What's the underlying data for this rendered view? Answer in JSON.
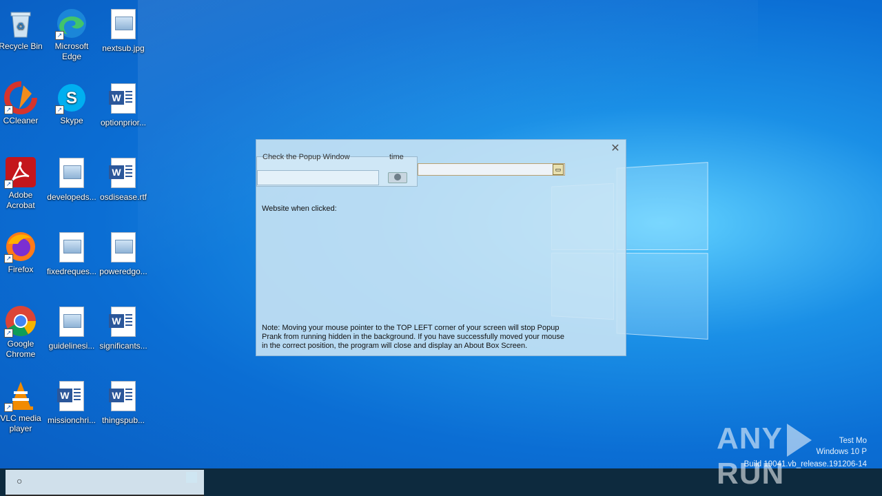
{
  "desktop": {
    "icons": [
      {
        "label": "Recycle Bin",
        "icon": "recycle-bin-icon"
      },
      {
        "label": "Microsoft Edge",
        "icon": "edge-icon"
      },
      {
        "label": "nextsub.jpg",
        "icon": "image-file-icon"
      },
      {
        "label": "CCleaner",
        "icon": "ccleaner-icon"
      },
      {
        "label": "Skype",
        "icon": "skype-icon"
      },
      {
        "label": "optionprior...",
        "icon": "word-doc-icon"
      },
      {
        "label": "Adobe Acrobat",
        "icon": "acrobat-icon"
      },
      {
        "label": "developeds...",
        "icon": "image-file-icon"
      },
      {
        "label": "osdisease.rtf",
        "icon": "word-doc-icon"
      },
      {
        "label": "Firefox",
        "icon": "firefox-icon"
      },
      {
        "label": "fixedreques...",
        "icon": "image-file-icon"
      },
      {
        "label": "poweredgo...",
        "icon": "image-file-icon"
      },
      {
        "label": "Google Chrome",
        "icon": "chrome-icon"
      },
      {
        "label": "guidelinesi...",
        "icon": "image-file-icon"
      },
      {
        "label": "significants...",
        "icon": "word-doc-icon"
      },
      {
        "label": "VLC media player",
        "icon": "vlc-icon"
      },
      {
        "label": "missionchri...",
        "icon": "word-doc-icon"
      },
      {
        "label": "thingspub...",
        "icon": "word-doc-icon"
      }
    ]
  },
  "dialog": {
    "close_glyph": "✕",
    "clipped_left_text": "Check the Popup Window",
    "clipped_right_text": "time",
    "website_label": "Website when clicked:",
    "note": "Note: Moving your mouse pointer to the TOP LEFT corner of your screen will stop Popup Prank from running hidden in the background. If you have successfully moved your mouse in the correct position, the program will close and display an About Box Screen."
  },
  "taskbar": {
    "search_icon": "search-icon"
  },
  "watermark": {
    "brand_left": "ANY",
    "brand_right": "RUN",
    "line1": "Test Mo",
    "line2": "Windows 10 P",
    "line3": "Build 19041.vb_release.191206-14"
  }
}
